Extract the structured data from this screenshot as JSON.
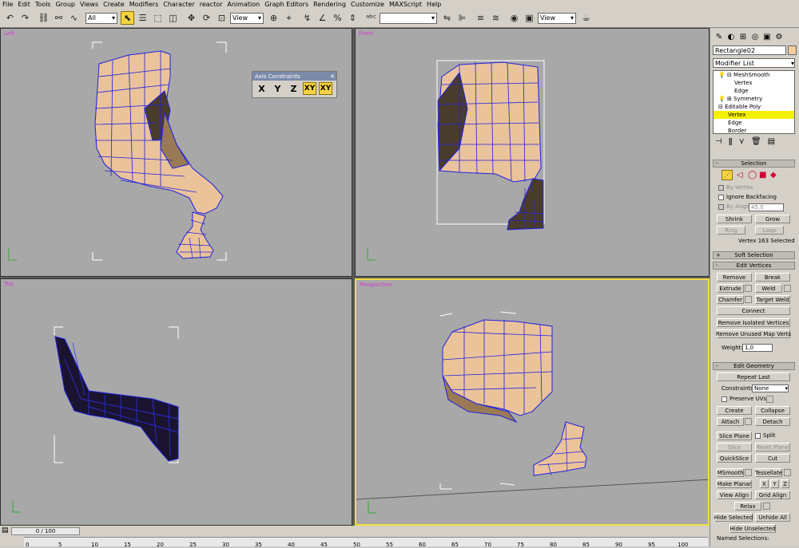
{
  "menu": [
    "File",
    "Edit",
    "Tools",
    "Group",
    "Views",
    "Create",
    "Modifiers",
    "Character",
    "reactor",
    "Animation",
    "Graph Editors",
    "Rendering",
    "Customize",
    "MAXScript",
    "Help"
  ],
  "toolbar": {
    "filter": "All",
    "ref_coord": "View",
    "named_sel": "",
    "ref_coord2": "View"
  },
  "viewports": {
    "left": "Left",
    "front": "Front",
    "top": "Top",
    "perspective": "Perspective"
  },
  "axis_constraints": {
    "title": "Axis Constraints",
    "x": "X",
    "y": "Y",
    "z": "Z",
    "xy": "XY",
    "xy_alt": "XY"
  },
  "command_panel": {
    "object_name": "Rectangle02",
    "modifier_list": "Modifier List",
    "stack": [
      "MeshSmooth",
      "Vertex",
      "Edge",
      "Symmetry",
      "Editable Poly",
      "Vertex",
      "Edge",
      "Border"
    ],
    "selection": {
      "title": "Selection",
      "by_vertex": "By Vertex",
      "ignore_backfacing": "Ignore Backfacing",
      "by_angle": "By Angle:",
      "angle_value": "45,0",
      "shrink": "Shrink",
      "grow": "Grow",
      "ring": "Ring",
      "loop": "Loop",
      "status": "Vertex 163 Selected"
    },
    "soft_selection": {
      "title": "Soft Selection"
    },
    "edit_vertices": {
      "title": "Edit Vertices",
      "remove": "Remove",
      "break": "Break",
      "extrude": "Extrude",
      "weld": "Weld",
      "chamfer": "Chamfer",
      "target_weld": "Target Weld",
      "connect": "Connect",
      "remove_isolated": "Remove Isolated Vertices",
      "remove_unused": "Remove Unused Map Verts",
      "weight_label": "Weight:",
      "weight_value": "1,0"
    },
    "edit_geometry": {
      "title": "Edit Geometry",
      "repeat_last": "Repeat Last",
      "constraints_label": "Constraints:",
      "constraints_value": "None",
      "preserve_uvs": "Preserve UVs",
      "create": "Create",
      "collapse": "Collapse",
      "attach": "Attach",
      "detach": "Detach",
      "slice_plane": "Slice Plane",
      "split": "Split",
      "slice": "Slice",
      "reset_plane": "Reset Plane",
      "quickslice": "QuickSlice",
      "cut": "Cut",
      "msmooth": "MSmooth",
      "tessellate": "Tessellate",
      "make_planar": "Make Planar",
      "x": "X",
      "y": "Y",
      "z": "Z",
      "view_align": "View Align",
      "grid_align": "Grid Align",
      "relax": "Relax",
      "hide_selected": "Hide Selected",
      "unhide_all": "Unhide All",
      "hide_unselected": "Hide Unselected",
      "named_selections": "Named Selections:"
    }
  },
  "timeline": {
    "frame": "0 / 100",
    "ticks": [
      "0",
      "5",
      "10",
      "15",
      "20",
      "25",
      "30",
      "35",
      "40",
      "45",
      "50",
      "55",
      "60",
      "65",
      "70",
      "75",
      "80",
      "85",
      "90",
      "95",
      "100"
    ]
  },
  "colors": {
    "ui": "#d4d0c8",
    "viewport": "#a8a8a8",
    "label": "#d23ad2",
    "active_border": "#f0e040",
    "wire": "#2020e0",
    "skin": "#f4cfa0"
  }
}
